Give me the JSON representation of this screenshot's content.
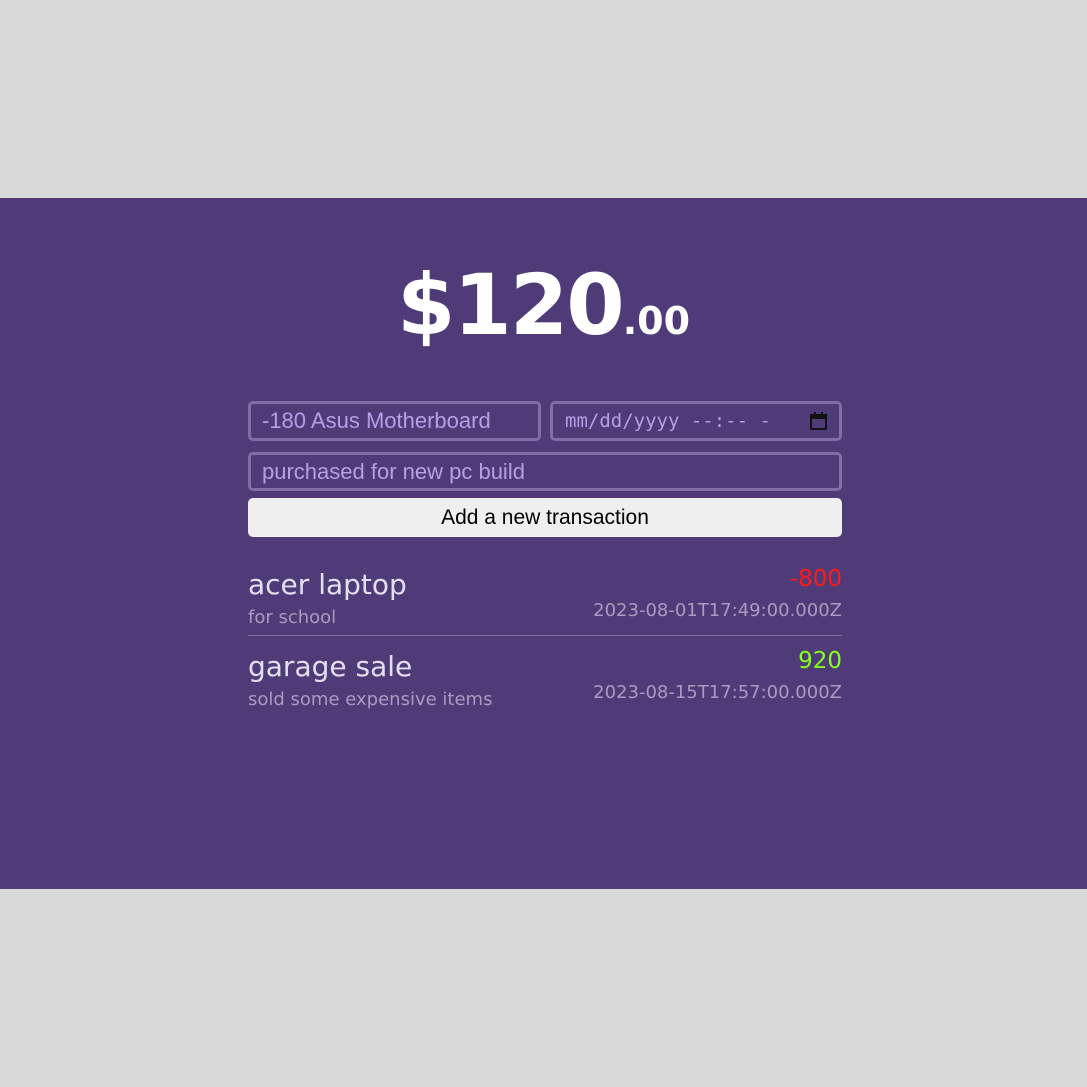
{
  "balance": {
    "main": "$120",
    "cents": ".00"
  },
  "form": {
    "name_placeholder": "-180 Asus Motherboard",
    "datetime_placeholder": "mm/dd/yyyy --:-- -",
    "description_placeholder": "purchased for new pc build",
    "submit_label": "Add a new transaction"
  },
  "transactions": [
    {
      "title": "acer laptop",
      "description": "for school",
      "amount": "-800",
      "datetime": "2023-08-01T17:49:00.000Z",
      "amount_color": "#ff1a1a"
    },
    {
      "title": "garage sale",
      "description": "sold some expensive items",
      "amount": "920",
      "datetime": "2023-08-15T17:57:00.000Z",
      "amount_color": "#86ff1a"
    }
  ],
  "colors": {
    "page_bg": "#d8d8d8",
    "app_bg": "#4e3b77",
    "positive": "#86ff1a",
    "negative": "#ff1a1a"
  },
  "icons": {
    "date_picker": "calendar-icon"
  }
}
